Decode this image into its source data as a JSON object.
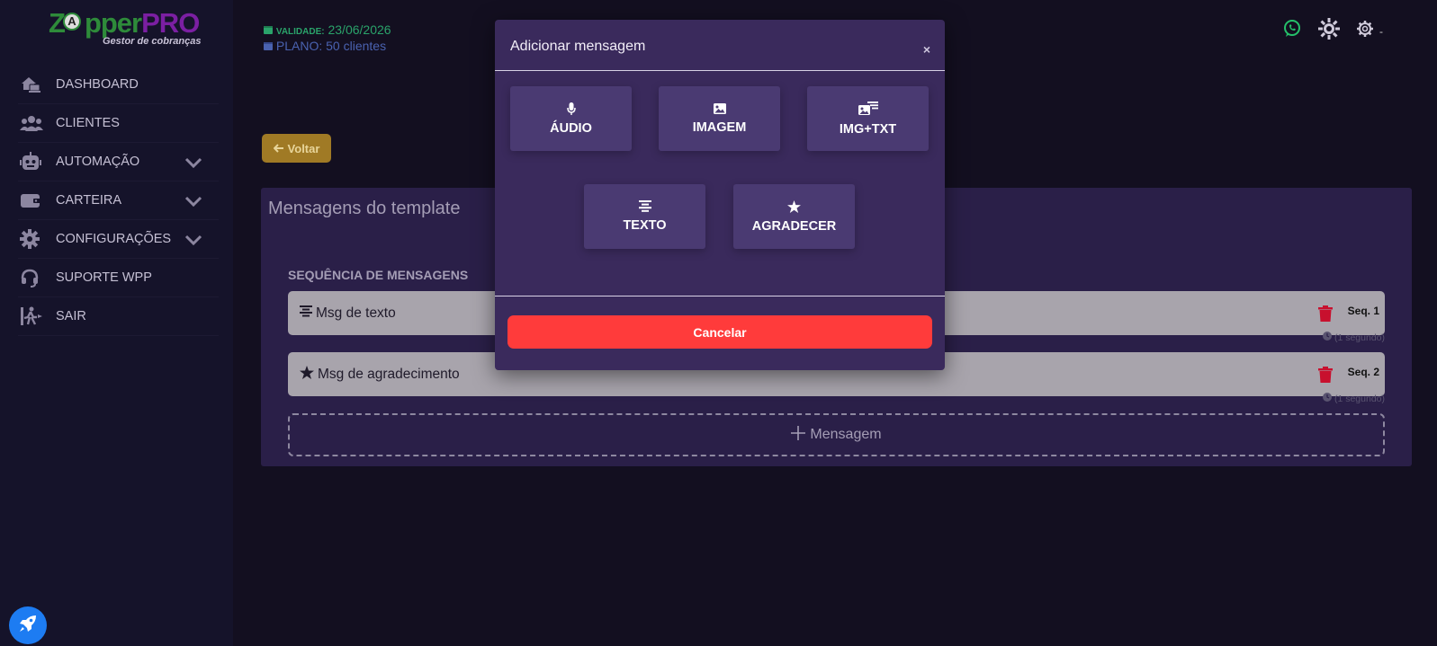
{
  "brand": {
    "logo_main_left": "Z",
    "logo_mid": "pper",
    "logo_pro": "PRO",
    "logo_a": "A",
    "logo_sub": "Gestor de cobranças"
  },
  "sidebar": {
    "items": [
      {
        "label": "DASHBOARD",
        "icon": "house-laptop-icon"
      },
      {
        "label": "CLIENTES",
        "icon": "users-icon"
      },
      {
        "label": "AUTOMAÇÃO",
        "icon": "robot-icon",
        "expandable": true
      },
      {
        "label": "CARTEIRA",
        "icon": "wallet-icon",
        "expandable": true
      },
      {
        "label": "CONFIGURAÇÕES",
        "icon": "gear-icon",
        "expandable": true
      },
      {
        "label": "SUPORTE WPP",
        "icon": "headset-icon"
      },
      {
        "label": "SAIR",
        "icon": "person-walking-exit-icon"
      }
    ]
  },
  "header": {
    "validity_label": "VALIDADE:",
    "validity_value": "23/06/2026",
    "plan_label": "PLANO:",
    "plan_value": "50 clientes",
    "user_dash": "-"
  },
  "back_button": {
    "label": "Voltar"
  },
  "template": {
    "title": "Mensagens do template",
    "sequence_title": "SEQUÊNCIA DE MENSAGENS",
    "messages": [
      {
        "label": "Msg de texto",
        "icon": "align-center-icon",
        "seq": "Seq. 1",
        "delay": "(1 segundo)"
      },
      {
        "label": "Msg de agradecimento",
        "icon": "star-icon",
        "seq": "Seq. 2",
        "delay": "(1 segundo)"
      }
    ],
    "add_label": "Mensagem"
  },
  "modal": {
    "title": "Adicionar mensagem",
    "close": "×",
    "options": [
      {
        "label": "ÁUDIO",
        "icon": "microphone-icon"
      },
      {
        "label": "IMAGEM",
        "icon": "image-icon"
      },
      {
        "label": "IMG+TXT",
        "icon": "image-text-icon"
      },
      {
        "label": "TEXTO",
        "icon": "align-center-icon"
      },
      {
        "label": "AGRADECER",
        "icon": "star-icon"
      }
    ],
    "cancel": "Cancelar"
  },
  "colors": {
    "accent": "#ff3b3b",
    "card": "#2a1f48",
    "modal": "#3a2a5c",
    "option": "#4a3a72",
    "green": "#2aa36a",
    "blue": "#4a62b0",
    "voltar": "#a07a25",
    "rocket": "#1d7cf2"
  }
}
